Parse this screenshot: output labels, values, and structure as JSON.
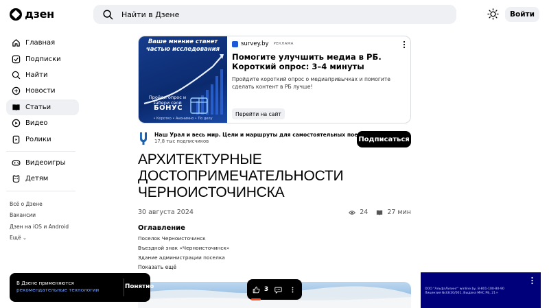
{
  "header": {
    "logo_text": "дзен",
    "search_placeholder": "Найти в Дзене",
    "login_label": "Войти"
  },
  "sidebar": {
    "items": [
      {
        "label": "Главная",
        "icon": "home-icon"
      },
      {
        "label": "Подписки",
        "icon": "subscriptions-icon"
      },
      {
        "label": "Найти",
        "icon": "search-icon"
      },
      {
        "label": "Новости",
        "icon": "news-icon"
      },
      {
        "label": "Статьи",
        "icon": "articles-icon",
        "active": true
      },
      {
        "label": "Видео",
        "icon": "video-icon"
      },
      {
        "label": "Ролики",
        "icon": "shorts-icon"
      },
      {
        "label": "Видеоигры",
        "icon": "gamepad-icon"
      },
      {
        "label": "Детям",
        "icon": "kids-icon"
      }
    ],
    "footer": [
      "Всё о Дзене",
      "Вакансии",
      "Дзен на iOS и Android",
      "Ещё"
    ]
  },
  "ad": {
    "image_heading": "Ваше мнение станет частью исследования",
    "image_mid": "Пройди опрос и забери свой",
    "image_bonus": "БОНУС",
    "image_footer": "• Коротко • Анонимно • По делу",
    "source": "survey.by",
    "label": "РЕКЛАМА",
    "title": "Помогите улучшить медиа в РБ. Короткий опрос: 3–4 минуты",
    "description": "Пройдите короткий опрос о медиапривычках и помогите сделать контент в РБ лучше!",
    "cta": "Перейти на сайт"
  },
  "channel": {
    "name": "Наш Урал и весь мир. Цели и маршруты для самостоятельных поездок",
    "subscribers": "17,8 тыс подписчиков",
    "subscribe_label": "Подписаться"
  },
  "article": {
    "title": "АРХИТЕКТУРНЫЕ ДОСТОПРИМЕЧАТЕЛЬНОСТИ ЧЕРНОИСТОЧИНСКА",
    "date": "30 августа 2024",
    "views": "24",
    "read_time": "27 мин",
    "toc_title": "Оглавление",
    "toc": [
      "Поселок Черноисточинск",
      "Въездной знак «Черноисточинск»",
      "Здание администрации поселка"
    ],
    "toc_more": "Показать ещё"
  },
  "reactions": {
    "likes": "3"
  },
  "cookie_toast": {
    "text": "В Дзене применяются",
    "link": "рекомендательные технологии",
    "button": "Понятно"
  },
  "video_ad": {
    "text": "ООО \"АльфаЛизинг\" winline.by, 8-801-100-80-90 Лицензия №33/20/001, Выдана МНС РБ, 21+"
  }
}
